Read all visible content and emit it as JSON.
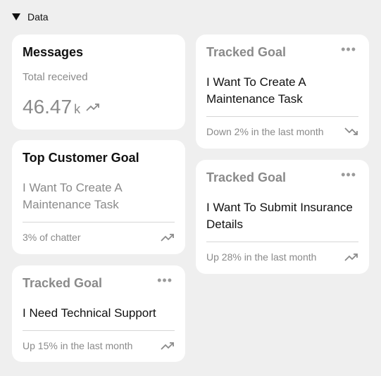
{
  "section": {
    "label": "Data"
  },
  "messages": {
    "title": "Messages",
    "subtitle": "Total received",
    "value": "46.47",
    "unit": "k",
    "trend_icon": "trend-up-icon"
  },
  "top_goal": {
    "title": "Top Customer Goal",
    "goal": "I Want To Create A Maintenance Task",
    "footer": "3% of chatter",
    "trend_icon": "trend-up-icon"
  },
  "tracked_goals": [
    {
      "title": "Tracked Goal",
      "goal": "I Need Technical Support",
      "footer": "Up 15% in the last month",
      "trend_icon": "trend-up-icon"
    },
    {
      "title": "Tracked Goal",
      "goal": "I Want To Create A Maintenance Task",
      "footer": "Down 2% in the last month",
      "trend_icon": "trend-down-icon"
    },
    {
      "title": "Tracked Goal",
      "goal": "I Want To Submit Insurance Details",
      "footer": "Up 28% in the last month",
      "trend_icon": "trend-up-icon"
    }
  ],
  "more_label": "•••",
  "colors": {
    "background": "#efefef",
    "card": "#ffffff",
    "muted": "#8a8a8a"
  }
}
